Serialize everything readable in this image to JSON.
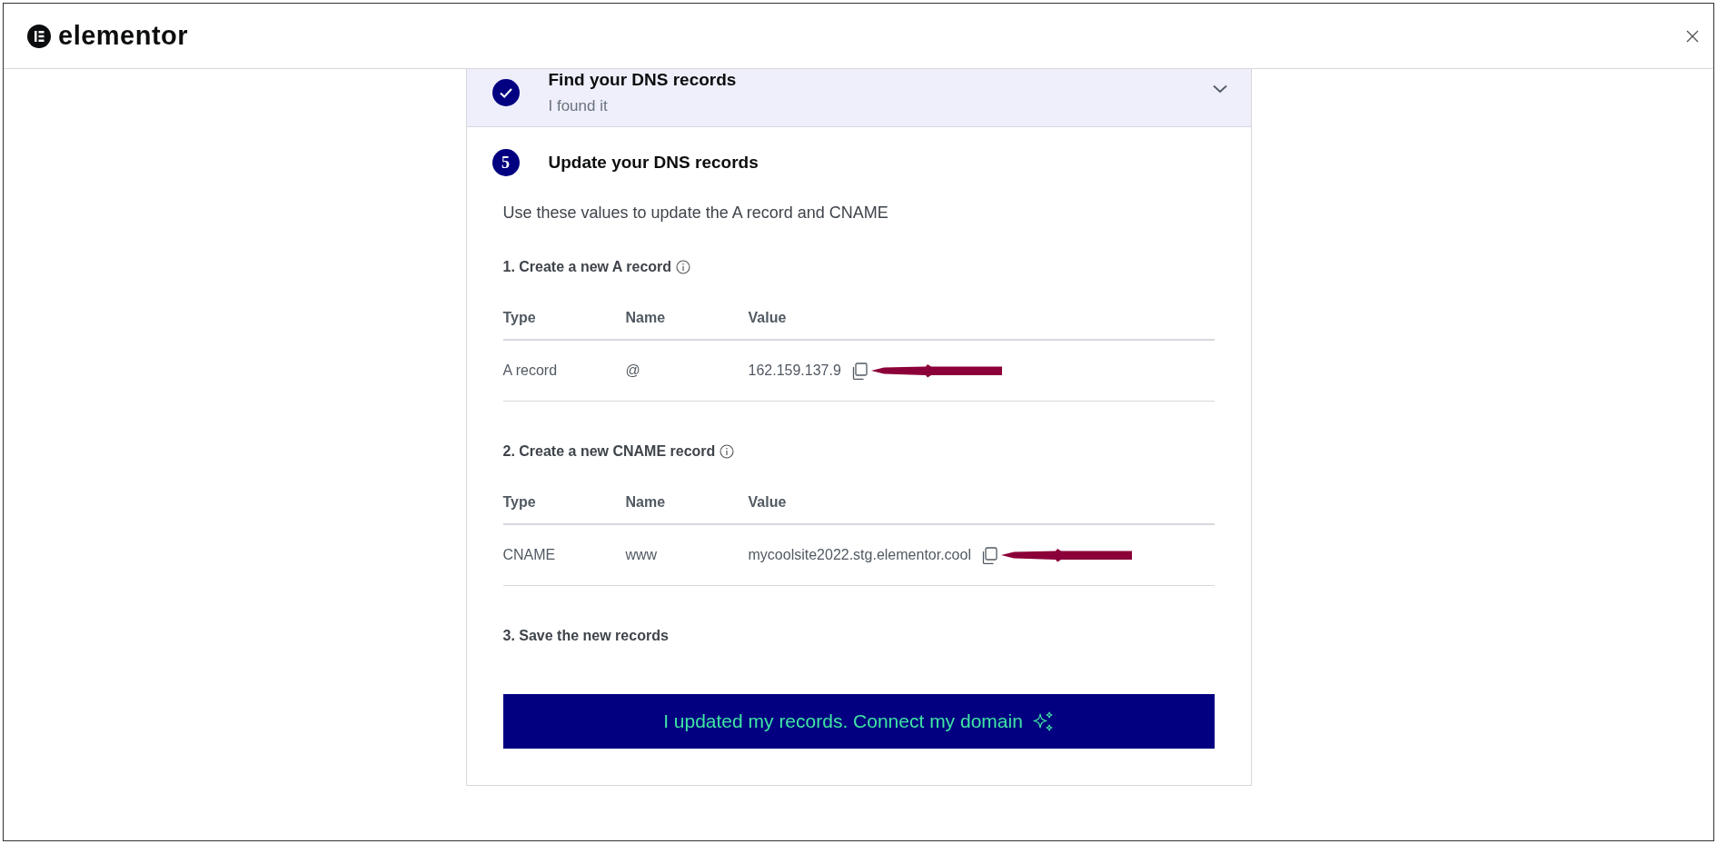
{
  "header": {
    "logo_text": "elementor"
  },
  "steps": [
    {
      "title": "Find your DNS records",
      "subtitle": "I found it",
      "completed": true,
      "expanded": false
    },
    {
      "number": "5",
      "title": "Update your DNS records",
      "completed": false,
      "expanded": true,
      "description": "Use these values to update the A record and CNAME",
      "sections": [
        {
          "heading": "1. Create a new A record",
          "info": true,
          "columns": [
            "Type",
            "Name",
            "Value"
          ],
          "rows": [
            {
              "cells": [
                "A record",
                "@",
                "162.159.137.9"
              ],
              "copyable": true,
              "annotated": true
            }
          ]
        },
        {
          "heading": "2. Create a new CNAME record",
          "info": true,
          "columns": [
            "Type",
            "Name",
            "Value"
          ],
          "rows": [
            {
              "cells": [
                "CNAME",
                "www",
                "mycoolsite2022.stg.elementor.cool"
              ],
              "copyable": true,
              "annotated": true
            }
          ]
        },
        {
          "heading": "3. Save the new records",
          "info": false
        }
      ],
      "button": {
        "label": "I updated my records. Connect my domain",
        "sparkle": true
      }
    }
  ]
}
